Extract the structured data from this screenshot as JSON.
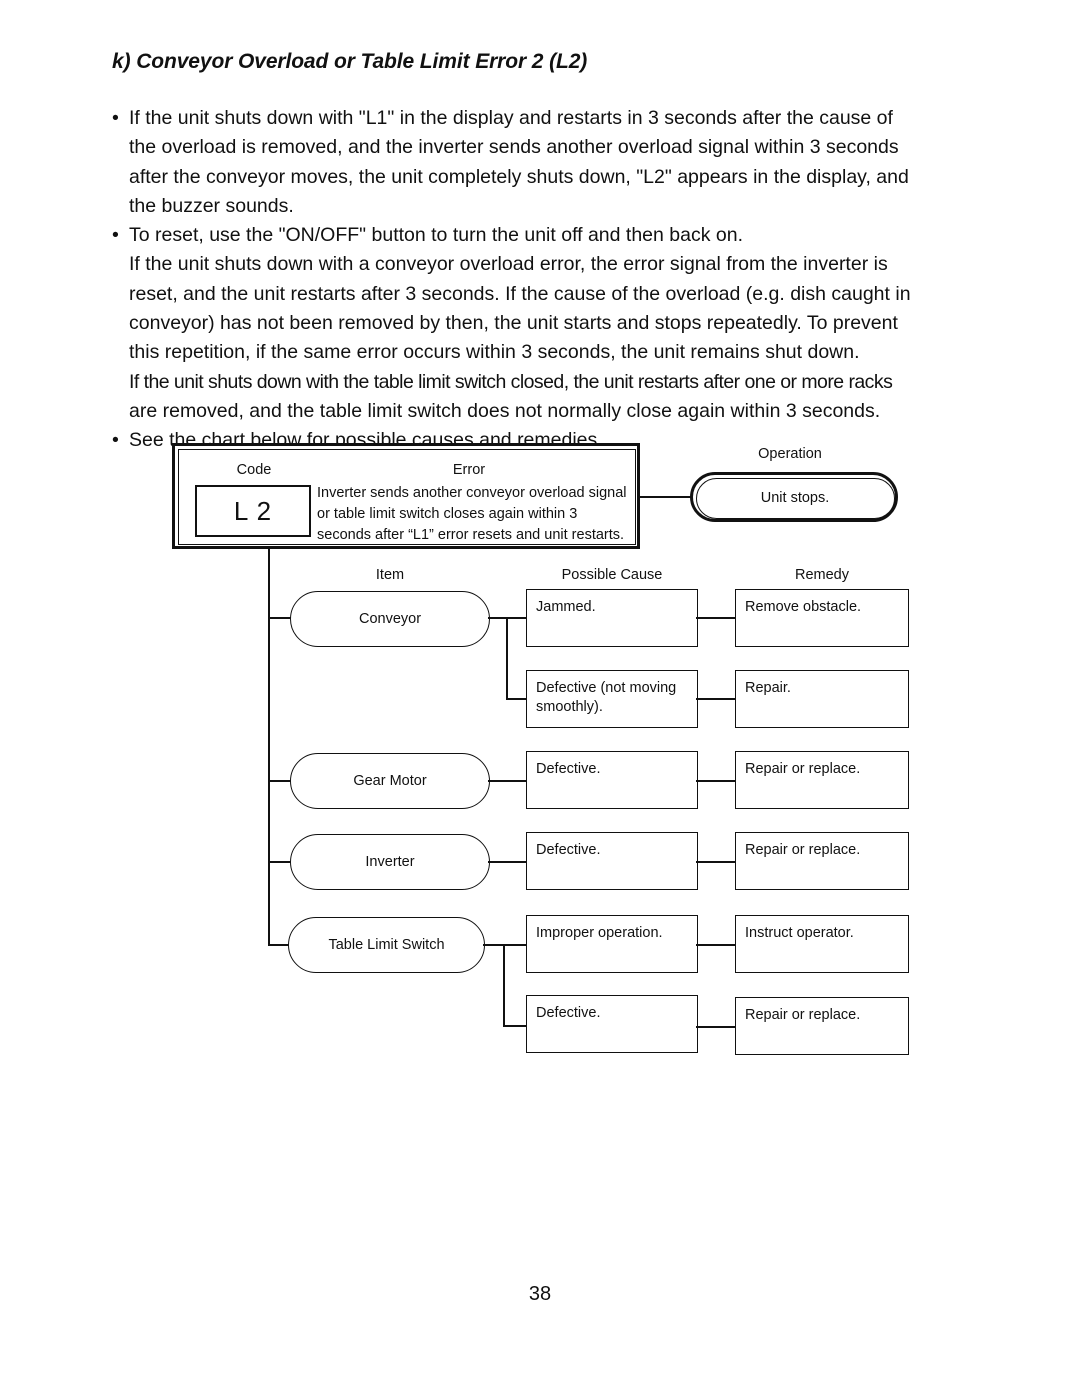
{
  "document": {
    "heading": "k) Conveyor Overload or Table Limit Error 2 (L2)",
    "page_number": "38"
  },
  "body": {
    "bullet_glyph": "•",
    "bullets": [
      {
        "lines": [
          "If the unit shuts down with \"L1\" in the display and restarts in 3 seconds after the cause of",
          "the overload is removed, and the inverter sends another overload signal within 3 seconds",
          "after the conveyor moves, the unit completely shuts down, \"L2\" appears in the display, and",
          "the buzzer sounds."
        ]
      },
      {
        "lines": [
          "To reset, use the \"ON/OFF\" button to turn the unit off and then back on.",
          "If the unit shuts down with a conveyor overload error, the error signal from the inverter is",
          "reset, and the unit restarts after 3 seconds. If the cause of the overload (e.g. dish caught in",
          "conveyor) has not been removed by then, the unit starts and stops repeatedly. To prevent",
          "this repetition, if the same error occurs within 3 seconds, the unit remains shut down."
        ],
        "tight_lines": [
          "If the unit shuts down with the table limit switch closed, the unit restarts after one or more racks",
          "are removed, and the table limit switch does not normally close again within 3 seconds."
        ]
      },
      {
        "lines": [
          "See the chart below for possible causes and remedies."
        ]
      }
    ]
  },
  "chart_data": {
    "type": "table",
    "title": "Error code L2 troubleshooting chart",
    "header": {
      "code_label": "Code",
      "error_label": "Error",
      "operation_label": "Operation",
      "code_value": "L 2",
      "error_lines": [
        "Inverter sends another conveyor overload signal",
        "or table limit switch closes again within 3",
        "seconds after “L1” error resets and unit restarts."
      ],
      "operation_value": "Unit stops."
    },
    "columns": [
      "Item",
      "Possible Cause",
      "Remedy"
    ],
    "rows": [
      {
        "item": "Conveyor",
        "cause": "Jammed.",
        "remedy": "Remove obstacle."
      },
      {
        "item": "",
        "cause": "Defective (not moving smoothly).",
        "remedy": "Repair."
      },
      {
        "item": "Gear Motor",
        "cause": "Defective.",
        "remedy": "Repair or replace."
      },
      {
        "item": "Inverter",
        "cause": "Defective.",
        "remedy": "Repair or replace."
      },
      {
        "item": "Table Limit Switch",
        "cause": "Improper operation.",
        "remedy": "Instruct operator."
      },
      {
        "item": "",
        "cause": "Defective.",
        "remedy": "Repair or replace."
      }
    ]
  }
}
